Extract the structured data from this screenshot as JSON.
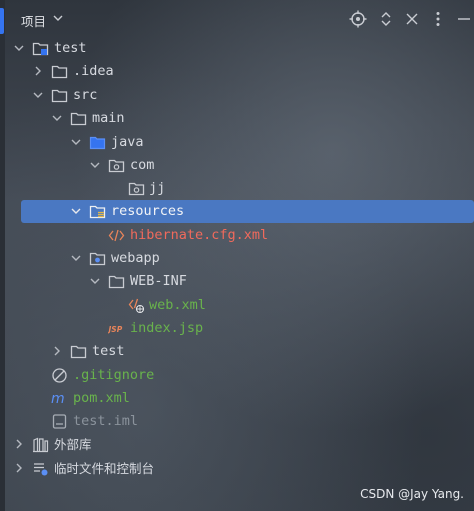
{
  "panel": {
    "title": "项目"
  },
  "tree": {
    "test": "test",
    "idea": ".idea",
    "src": "src",
    "main": "main",
    "java": "java",
    "com": "com",
    "jj": "jj",
    "resources": "resources",
    "hibernate": "hibernate.cfg.xml",
    "webapp": "webapp",
    "webinf": "WEB-INF",
    "webxml": "web.xml",
    "indexjsp": "index.jsp",
    "test2": "test",
    "gitignore": ".gitignore",
    "pom": "pom.xml",
    "iml": "test.iml",
    "external": "外部库",
    "scratches": "临时文件和控制台"
  },
  "watermark": "CSDN @Jay Yang.",
  "colors": {
    "selection": "#4a78c2",
    "error_red": "#f06a5c",
    "added_green": "#69b34c",
    "ignored_gray": "#8b939c"
  }
}
